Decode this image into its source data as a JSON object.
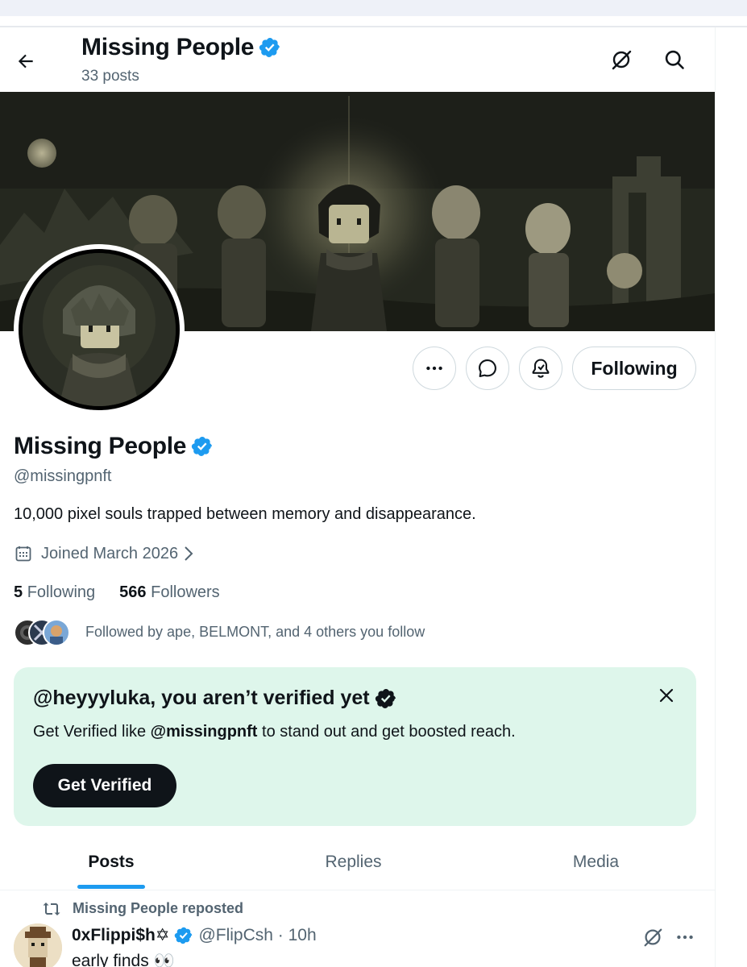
{
  "header": {
    "title": "Missing People",
    "posts_count": "33 posts"
  },
  "profile": {
    "name": "Missing People",
    "handle": "@missingpnft",
    "bio": "10,000 pixel souls trapped between memory and disappearance.",
    "joined": "Joined March 2026",
    "following_count": "5",
    "following_label": "Following",
    "followers_count": "566",
    "followers_label": "Followers",
    "followed_by": "Followed by ape, BELMONT, and 4 others you follow"
  },
  "actions": {
    "following_button": "Following"
  },
  "verify_card": {
    "title": "@heyyyluka, you aren’t verified yet",
    "text_before": "Get Verified like ",
    "text_handle": "@missingpnft",
    "text_after": " to stand out and get boosted reach.",
    "button": "Get Verified"
  },
  "tabs": [
    {
      "label": "Posts",
      "active": true
    },
    {
      "label": "Replies",
      "active": false
    },
    {
      "label": "Media",
      "active": false
    }
  ],
  "post": {
    "repost_label": "Missing People reposted",
    "author": "0xFlippi$h✡",
    "handle_time": "@FlipCsh · 10h",
    "text": "early finds 👀"
  },
  "colors": {
    "accent": "#1d9bf0",
    "verify_card_bg": "#def6eb",
    "text_primary": "#0f1419",
    "text_secondary": "#536471"
  },
  "icons": {
    "back": "arrow-left-icon",
    "grok": "grok-icon",
    "search": "search-icon",
    "more": "more-icon",
    "message": "message-icon",
    "notify": "bell-icon",
    "calendar": "calendar-icon",
    "close": "close-icon",
    "repost": "repost-icon",
    "verified": "verified-badge-icon"
  }
}
